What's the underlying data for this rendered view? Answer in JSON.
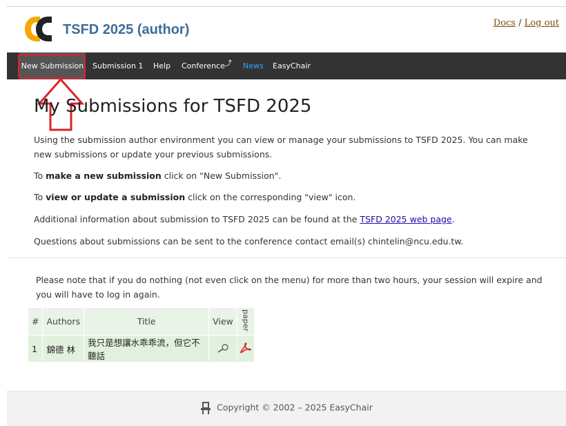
{
  "header": {
    "title": "TSFD 2025 (author)",
    "docs_link": "Docs",
    "separator": "/",
    "logout_link": "Log out",
    "logo_colors": {
      "primary": "#f5a800",
      "dark": "#222222"
    }
  },
  "menu": {
    "items": [
      {
        "label": "New Submission"
      },
      {
        "label": "Submission 1"
      },
      {
        "label": "Help"
      },
      {
        "label": "Conference"
      },
      {
        "label": "News"
      },
      {
        "label": "EasyChair"
      }
    ],
    "highlight_color": "#e0212a"
  },
  "main": {
    "title": "My Submissions for TSFD 2025",
    "intro": "Using the submission author environment you can view or manage your submissions to TSFD 2025. You can make new submissions or update your previous submissions.",
    "new_sub": {
      "prefix": "To ",
      "bold": "make a new submission",
      "suffix": " click on \"New Submission\"."
    },
    "update_sub": {
      "prefix": "To ",
      "bold": "view or update a submission",
      "suffix": " click on the corresponding \"view\" icon."
    },
    "additional": {
      "prefix": "Additional information about submission to TSFD 2025 can be found at the ",
      "link": "TSFD 2025 web page",
      "suffix": "."
    },
    "questions": "Questions about submissions can be sent to the conference contact email(s) chintelin@ncu.edu.tw."
  },
  "notice": "Please note that if you do nothing (not even click on the menu) for more than two hours, your session will expire and you will have to log in again.",
  "table": {
    "headers": {
      "num": "#",
      "authors": "Authors",
      "title": "Title",
      "view": "View",
      "paper": "paper"
    },
    "rows": [
      {
        "num": "1",
        "authors": "錦德 林",
        "title": "我只是想讓水乖乖流，但它不聽話",
        "view_icon": "magnifier-icon",
        "paper_icon": "pdf-icon"
      }
    ]
  },
  "footer": {
    "copyright": "Copyright © 2002 – 2025 EasyChair"
  }
}
